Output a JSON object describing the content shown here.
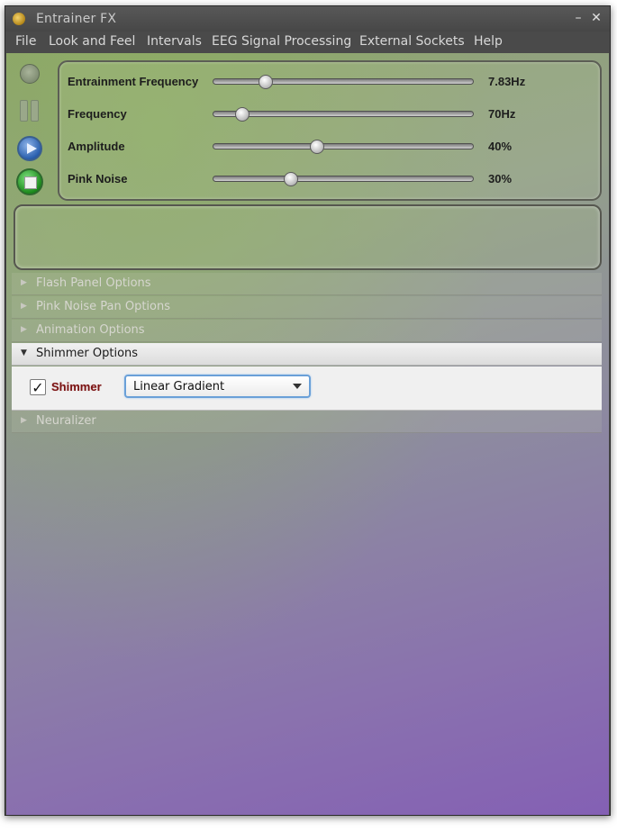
{
  "window": {
    "title": "Entrainer FX",
    "minimize_glyph": "–",
    "close_glyph": "✕"
  },
  "menu": [
    "File",
    "Look and Feel",
    "Intervals",
    "EEG Signal Processing",
    "External Sockets",
    "Help"
  ],
  "controls": {
    "icons": [
      "record-icon",
      "pause-icon",
      "play-icon",
      "stop-icon"
    ]
  },
  "sliders": [
    {
      "label": "Entrainment Frequency",
      "value": "7.83Hz",
      "fraction": 0.2
    },
    {
      "label": "Frequency",
      "value": "70Hz",
      "fraction": 0.11
    },
    {
      "label": "Amplitude",
      "value": "40%",
      "fraction": 0.4
    },
    {
      "label": "Pink Noise",
      "value": "30%",
      "fraction": 0.3
    }
  ],
  "accordion": {
    "flash_panel": "Flash Panel Options",
    "pink_noise_pan": "Pink Noise Pan Options",
    "animation": "Animation Options",
    "shimmer": "Shimmer Options",
    "neuralizer": "Neuralizer"
  },
  "shimmer": {
    "checkbox_label": "Shimmer",
    "checked": true,
    "check_glyph": "✓",
    "selected": "Linear Gradient"
  },
  "colors": {
    "accent": "#6aa0d8",
    "checkbox_label": "#7a1212",
    "background_top": "#8ea36e",
    "background_bottom": "#8460b4"
  }
}
